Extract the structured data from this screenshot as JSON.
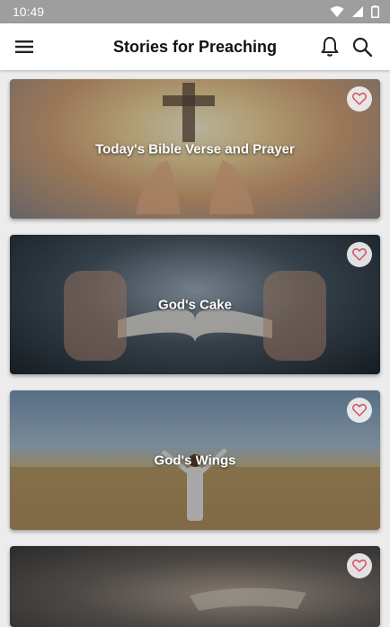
{
  "status_bar": {
    "time": "10:49"
  },
  "app_bar": {
    "title": "Stories for Preaching",
    "icons": [
      "menu-icon",
      "bell-icon",
      "search-icon"
    ]
  },
  "cards": [
    {
      "title": "Today's Bible Verse and Prayer",
      "favorite": false
    },
    {
      "title": "God's Cake",
      "favorite": false
    },
    {
      "title": "God's Wings",
      "favorite": false
    },
    {
      "title": "",
      "favorite": false
    }
  ],
  "colors": {
    "status_bar": "#9e9e9e",
    "app_bar": "#ffffff",
    "background": "#ececec",
    "favorite_heart": "#d9475a"
  }
}
